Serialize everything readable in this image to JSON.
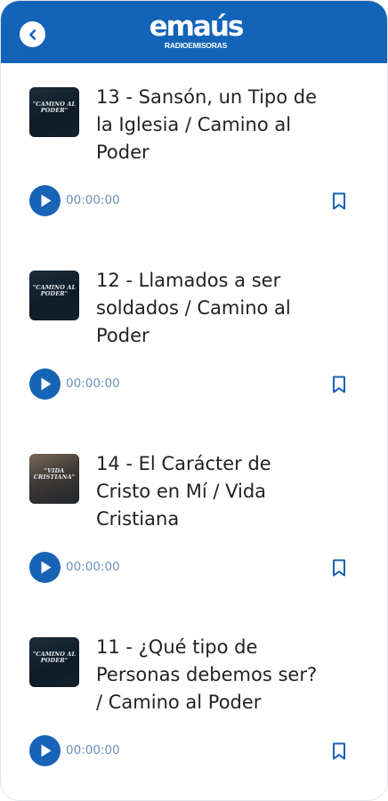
{
  "header": {
    "brand": "emaús",
    "brand_sub": "RADIOEMISORAS",
    "back_icon": "chevron-left-icon",
    "background_color": "#1364b8"
  },
  "episodes": [
    {
      "title_lines": [
        "13 - Sansón, un Tipo de",
        "la Iglesia / Camino al",
        "Poder"
      ],
      "thumb_text": [
        "\"CAMINO AL",
        "PODER\""
      ],
      "time": "00:00:00"
    },
    {
      "title_lines": [
        "12 - Llamados a ser",
        "soldados / Camino al",
        "Poder"
      ],
      "thumb_text": [
        "\"CAMINO AL",
        "PODER\""
      ],
      "time": "00:00:00"
    },
    {
      "title_lines": [
        "14 - El Carácter de",
        "Cristo en Mí / Vida",
        "Cristiana"
      ],
      "thumb_text": [
        "\"VIDA",
        "CRISTIANA\""
      ],
      "time": "00:00:00"
    },
    {
      "title_lines": [
        "11 - ¿Qué tipo de",
        "Personas debemos ser?",
        "/ Camino al Poder"
      ],
      "thumb_text": [
        "\"CAMINO AL",
        "PODER\""
      ],
      "time": "00:00:00"
    }
  ],
  "icons": {
    "play": "play-icon",
    "bookmark": "bookmark-icon"
  },
  "colors": {
    "accent": "#1763b6",
    "time_text": "#6d8fb8",
    "title_text": "#1f2124"
  }
}
